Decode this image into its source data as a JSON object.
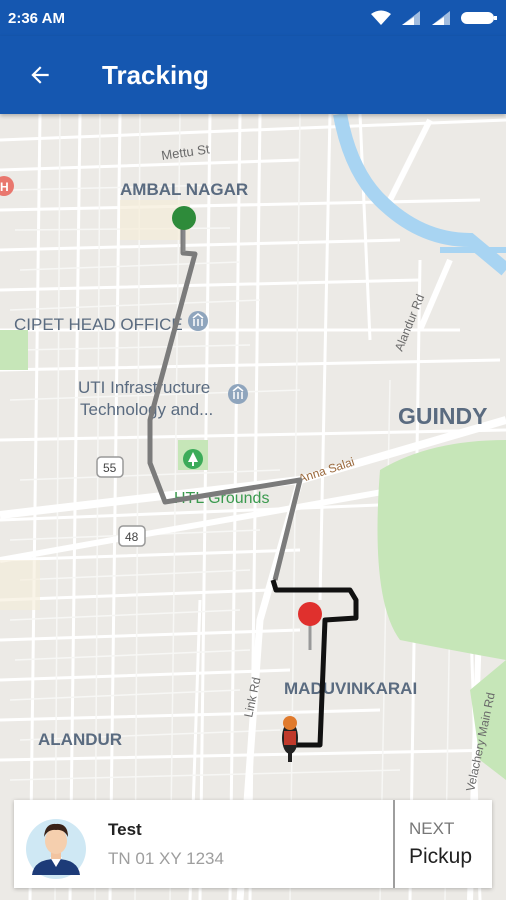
{
  "status_bar": {
    "time": "2:36 AM"
  },
  "app_bar": {
    "title": "Tracking"
  },
  "map": {
    "labels": {
      "mettu_st": "Mettu St",
      "ambal_nagar": "AMBAL NAGAR",
      "cipet": "CIPET HEAD OFFICE",
      "uti_line1": "UTI Infrastructure",
      "uti_line2": "Technology and...",
      "guindy": "GUINDY",
      "alandur_rd": "Alandur Rd",
      "anna_salai": "Anna Salai",
      "htl_grounds": "HTL Grounds",
      "route55": "55",
      "route48": "48",
      "link_rd": "Link Rd",
      "maduvinkarai": "MADUVINKARAI",
      "velachery": "Velachery Main Rd",
      "alandur": "ALANDUR"
    },
    "colors": {
      "route_gray": "#7b7b7b",
      "route_black": "#111111",
      "start_pin": "#2e8b3a",
      "dest_pin": "#e0302d",
      "park": "#c6e6b8",
      "water": "#a8d4f2"
    }
  },
  "driver_card": {
    "name": "Test",
    "plate": "TN 01 XY 1234",
    "next_label": "NEXT",
    "next_value": "Pickup"
  }
}
